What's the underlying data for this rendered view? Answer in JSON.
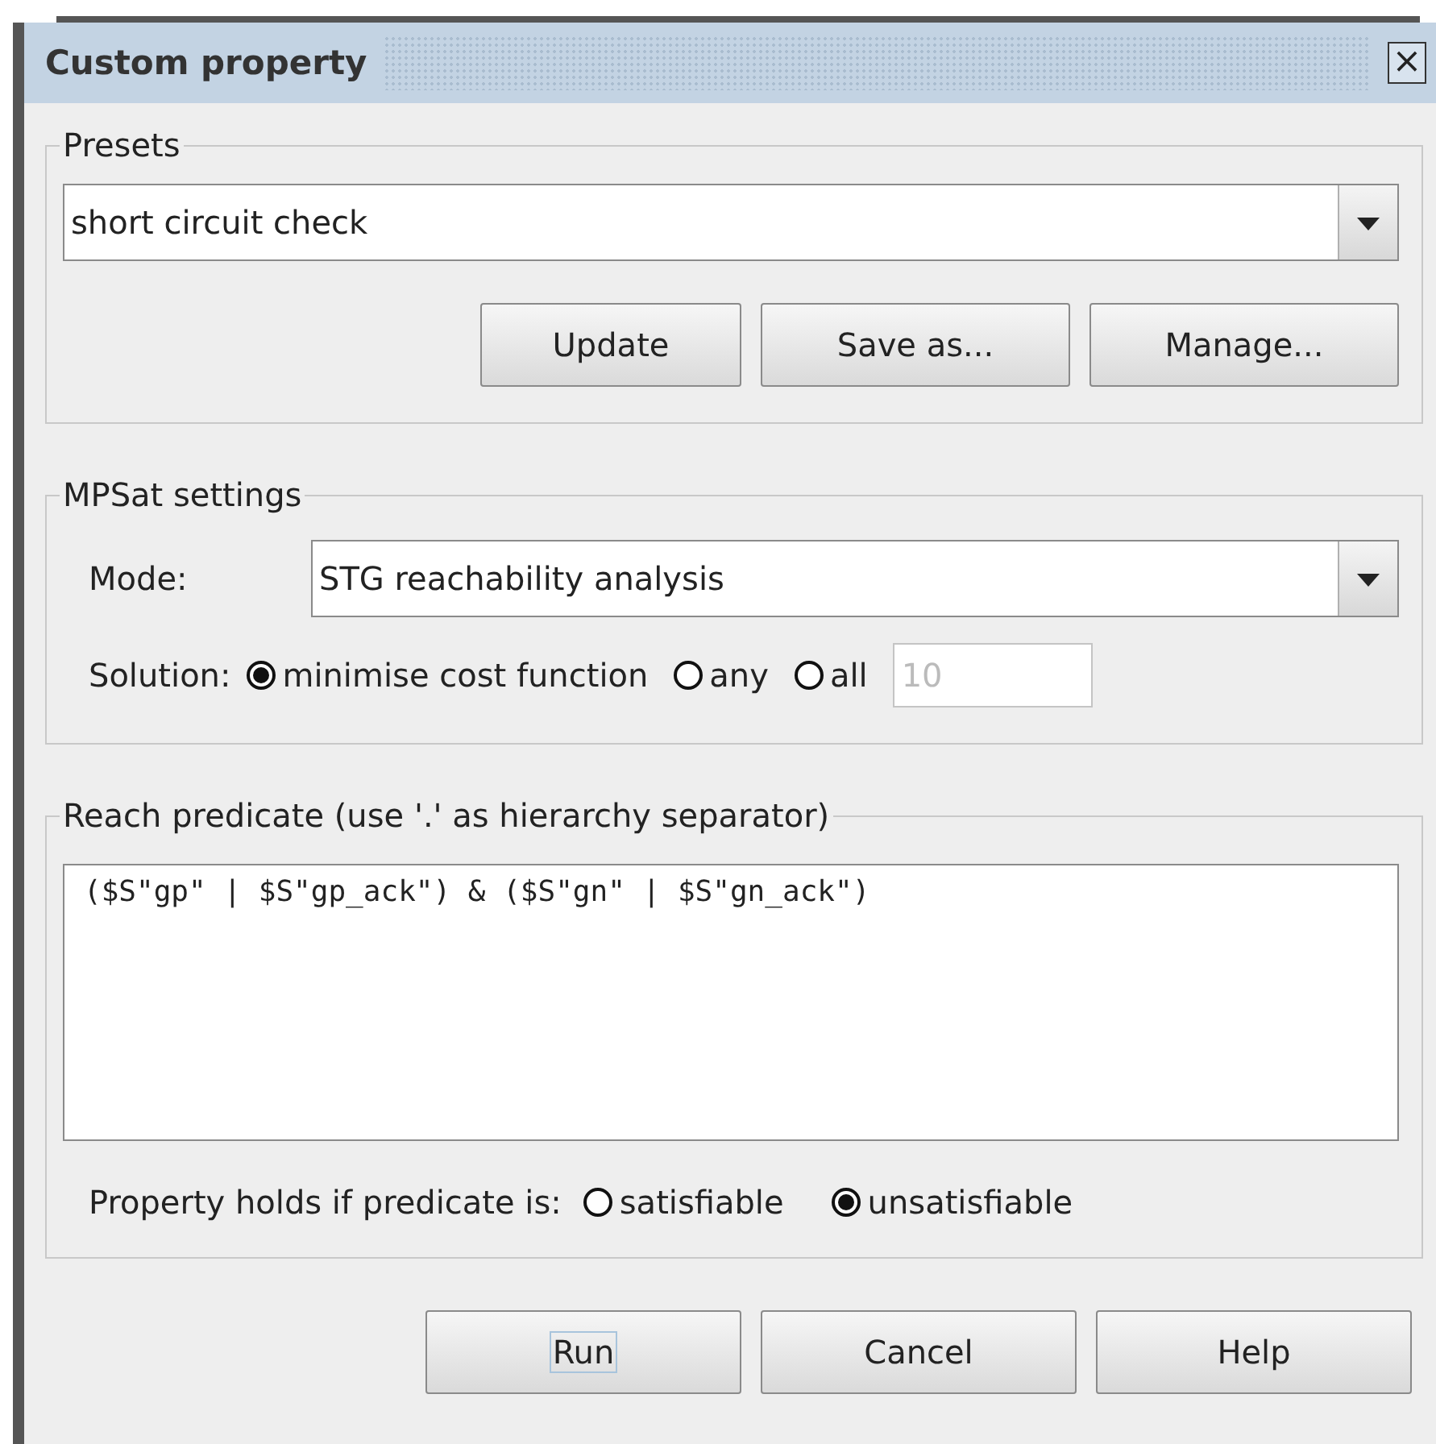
{
  "window": {
    "title": "Custom property",
    "close": "×"
  },
  "presets": {
    "legend": "Presets",
    "value": "short circuit check",
    "buttons": [
      {
        "label": "Update"
      },
      {
        "label": "Save as..."
      },
      {
        "label": "Manage..."
      }
    ]
  },
  "mpsat": {
    "legend": "MPSat settings",
    "mode_label": "Mode:",
    "mode_value": "STG reachability analysis",
    "solution_label": "Solution:",
    "options": [
      {
        "label": "minimise cost function",
        "selected": true
      },
      {
        "label": "any",
        "selected": false
      },
      {
        "label": "all",
        "selected": false
      }
    ],
    "count": {
      "value": "10",
      "disabled": true
    }
  },
  "reach": {
    "legend": "Reach predicate (use '.' as hierarchy separator)",
    "predicate": "($S\"gp\" | $S\"gp_ack\") & ($S\"gn\" | $S\"gn_ack\")",
    "holds_label": "Property holds if predicate is:",
    "options": [
      {
        "label": "satisfiable",
        "selected": false
      },
      {
        "label": "unsatisfiable",
        "selected": true
      }
    ]
  },
  "buttons": [
    {
      "label": "Run",
      "focused": true
    },
    {
      "label": "Cancel",
      "focused": false
    },
    {
      "label": "Help",
      "focused": false
    }
  ]
}
